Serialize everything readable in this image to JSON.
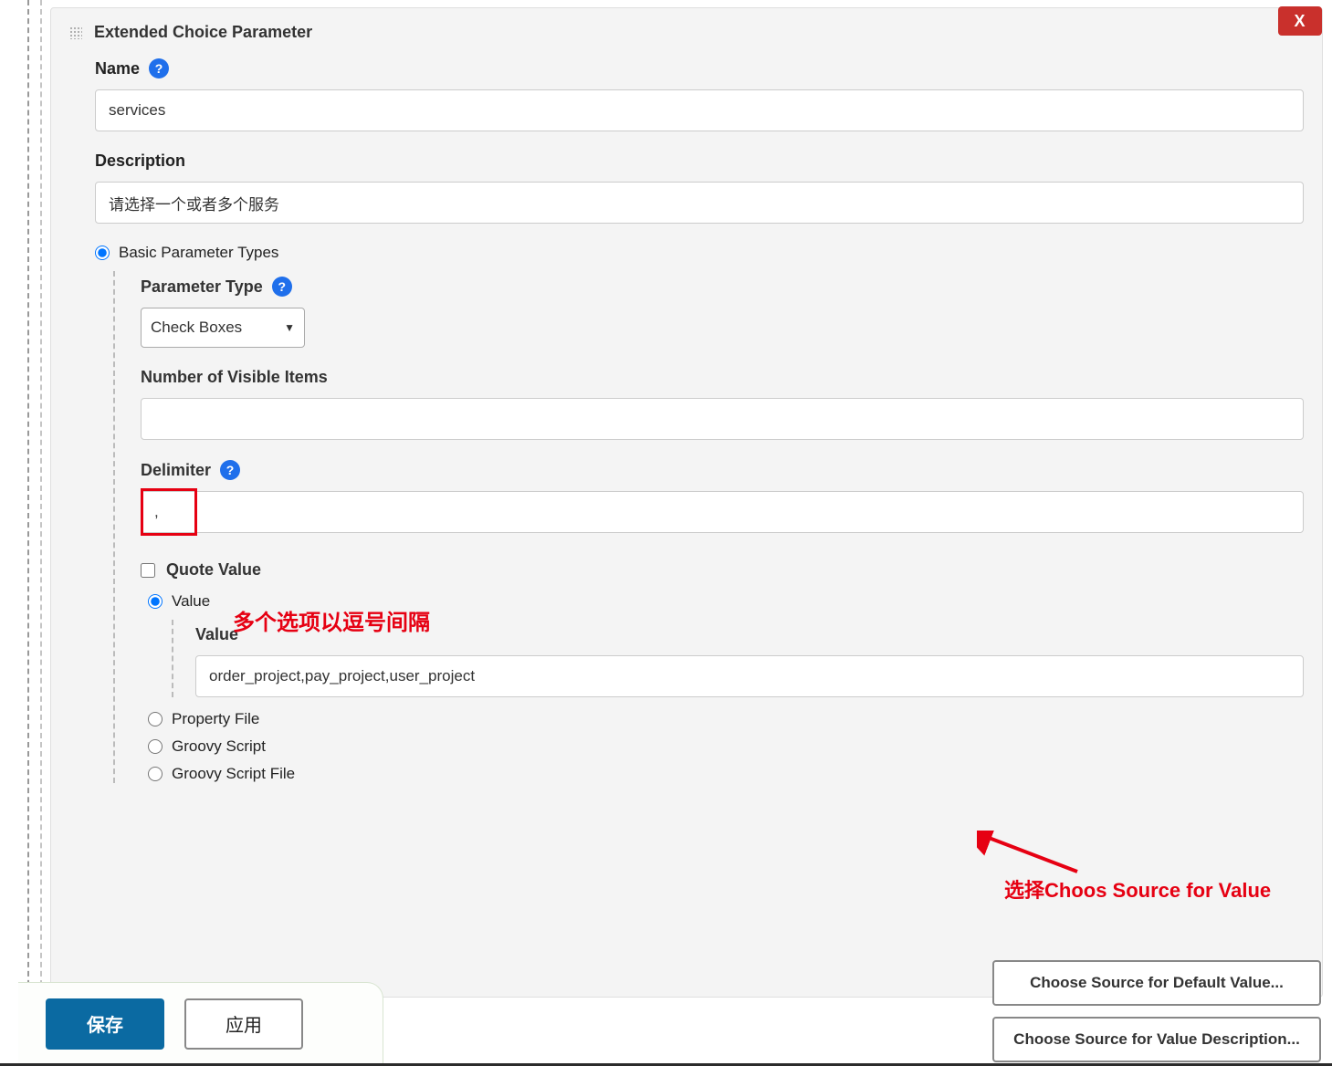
{
  "panel_title": "Extended Choice Parameter",
  "close_button": "X",
  "name": {
    "label": "Name",
    "value": "services"
  },
  "description": {
    "label": "Description",
    "value": "请选择一个或者多个服务"
  },
  "basic_param_types": {
    "label": "Basic Parameter Types",
    "parameter_type": {
      "label": "Parameter Type",
      "selected": "Check Boxes"
    },
    "num_visible": {
      "label": "Number of Visible Items",
      "value": ""
    },
    "delimiter": {
      "label": "Delimiter",
      "value": ","
    },
    "quote_value": {
      "label": "Quote Value",
      "checked": false
    },
    "value_section": {
      "radio_label": "Value",
      "field_label": "Value",
      "value": "order_project,pay_project,user_project"
    },
    "source_options": {
      "property_file": "Property File",
      "groovy_script": "Groovy Script",
      "groovy_script_file": "Groovy Script File"
    }
  },
  "annotations": {
    "delimiter_note": "多个选项以逗号间隔",
    "choose_source_note": "选择Choos Source for Value"
  },
  "footer_buttons": {
    "save": "保存",
    "apply": "应用"
  },
  "right_buttons": {
    "default_value": "Choose Source for Default Value...",
    "value_description": "Choose Source for Value Description..."
  }
}
